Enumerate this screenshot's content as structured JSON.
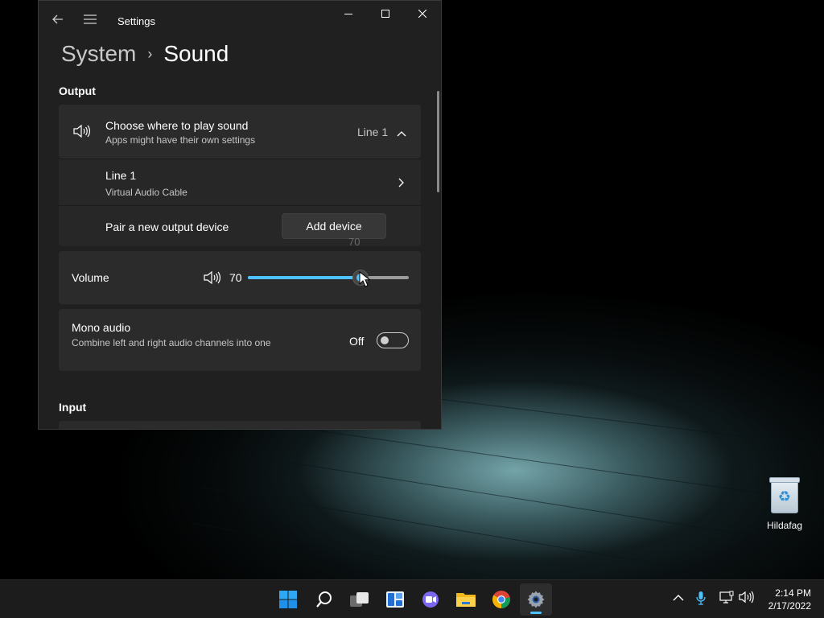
{
  "window": {
    "title": "Settings",
    "breadcrumb": {
      "parent": "System",
      "current": "Sound"
    }
  },
  "output": {
    "heading": "Output",
    "choose": {
      "title": "Choose where to play sound",
      "subtitle": "Apps might have their own settings",
      "selected": "Line 1"
    },
    "device": {
      "name": "Line 1",
      "description": "Virtual Audio Cable"
    },
    "pair": {
      "label": "Pair a new output device",
      "button": "Add device"
    },
    "volume": {
      "label": "Volume",
      "value": "70",
      "tooltip": "70",
      "level": 0.7
    },
    "mono": {
      "title": "Mono audio",
      "subtitle": "Combine left and right audio channels into one",
      "state": "Off"
    }
  },
  "input": {
    "heading": "Input"
  },
  "desktop": {
    "recycle_bin_label": "Hildafag"
  },
  "taskbar": {
    "apps": [
      "start-icon",
      "search-icon",
      "task-view-icon",
      "widgets-icon",
      "chat-icon",
      "file-explorer-icon",
      "chrome-icon",
      "settings-icon"
    ],
    "active_app": "settings-icon",
    "time": "2:14 PM",
    "date": "2/17/2022"
  },
  "colors": {
    "accent": "#4cc2ff",
    "window_bg": "#202020",
    "card_bg": "#2b2b2b"
  }
}
